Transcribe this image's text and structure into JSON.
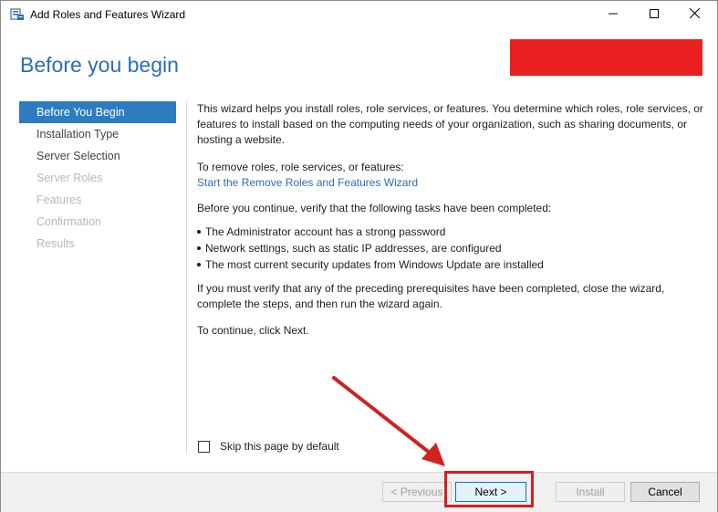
{
  "window": {
    "title": "Add Roles and Features Wizard",
    "icons": {
      "app": "server-manager-icon",
      "minimize": "minimize-icon",
      "maximize": "maximize-icon",
      "close": "close-icon"
    }
  },
  "header": {
    "page_title": "Before you begin",
    "redaction_color": "#e82020"
  },
  "nav": {
    "items": [
      {
        "label": "Before You Begin",
        "state": "active"
      },
      {
        "label": "Installation Type",
        "state": "enabled"
      },
      {
        "label": "Server Selection",
        "state": "enabled"
      },
      {
        "label": "Server Roles",
        "state": "disabled"
      },
      {
        "label": "Features",
        "state": "disabled"
      },
      {
        "label": "Confirmation",
        "state": "disabled"
      },
      {
        "label": "Results",
        "state": "disabled"
      }
    ]
  },
  "content": {
    "intro": "This wizard helps you install roles, role services, or features. You determine which roles, role services, or features to install based on the computing needs of your organization, such as sharing documents, or hosting a website.",
    "remove_label": "To remove roles, role services, or features:",
    "remove_link": "Start the Remove Roles and Features Wizard",
    "verify": "Before you continue, verify that the following tasks have been completed:",
    "bullets": [
      "The Administrator account has a strong password",
      "Network settings, such as static IP addresses, are configured",
      "The most current security updates from Windows Update are installed"
    ],
    "must_verify": "If you must verify that any of the preceding prerequisites have been completed, close the wizard, complete the steps, and then run the wizard again.",
    "to_continue": "To continue, click Next."
  },
  "skip": {
    "label": "Skip this page by default",
    "checked": false
  },
  "footer": {
    "previous": "< Previous",
    "next": "Next >",
    "install": "Install",
    "cancel": "Cancel"
  },
  "annotation": {
    "color": "#d32020"
  }
}
